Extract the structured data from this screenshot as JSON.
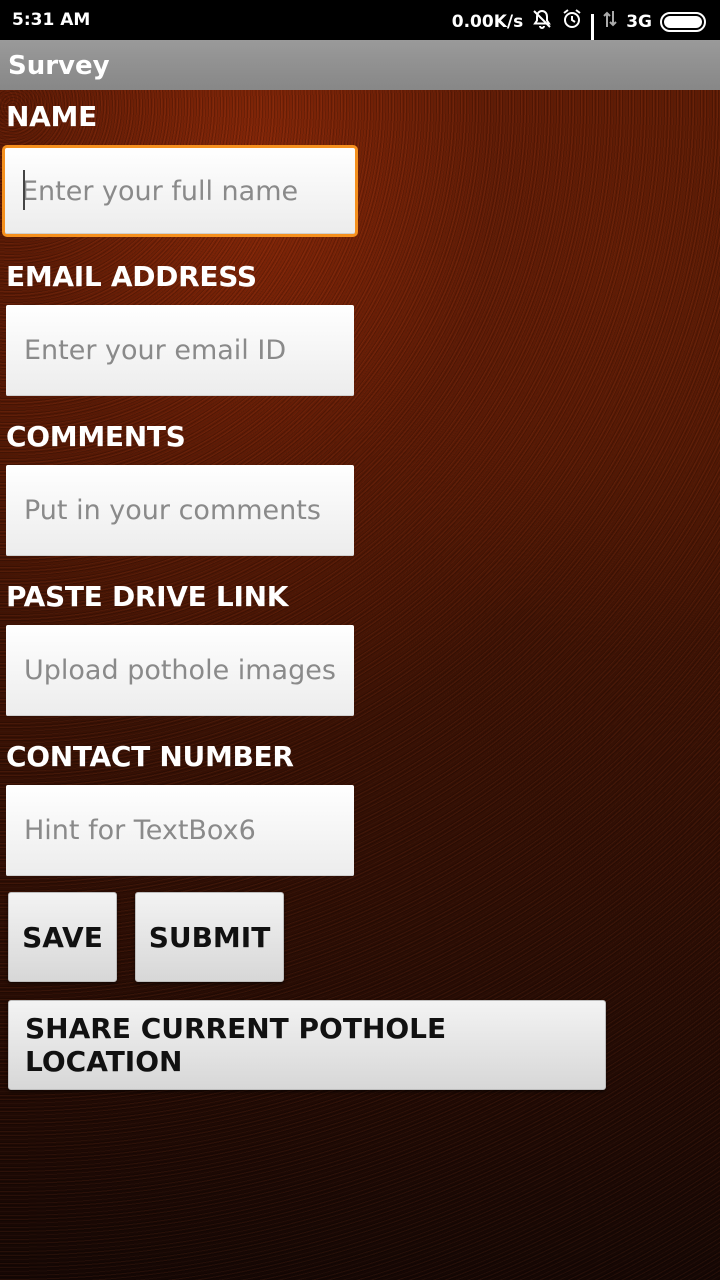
{
  "status_bar": {
    "time": "5:31 AM",
    "net_speed": "0.00K/s",
    "network": "3G",
    "icons": [
      "mute-bell-icon",
      "alarm-icon",
      "signal-icon",
      "no-data-icon",
      "battery-icon"
    ]
  },
  "app_bar": {
    "title": "Survey"
  },
  "form": {
    "name": {
      "label": "NAME",
      "placeholder": "Enter your full name",
      "focused": true
    },
    "email": {
      "label": "EMAIL ADDRESS",
      "placeholder": "Enter your email ID"
    },
    "comments": {
      "label": "COMMENTS",
      "placeholder": "Put in your comments"
    },
    "drive_link": {
      "label": "PASTE DRIVE LINK",
      "placeholder": "Upload pothole images"
    },
    "contact": {
      "label": "CONTACT NUMBER",
      "placeholder": "Hint for TextBox6"
    }
  },
  "buttons": {
    "save": "SAVE",
    "submit": "SUBMIT",
    "share_location": "SHARE CURRENT POTHOLE LOCATION"
  },
  "colors": {
    "focus_border": "#f5901e",
    "title_bar": "#8f8f8f",
    "background": "#4a1604"
  }
}
